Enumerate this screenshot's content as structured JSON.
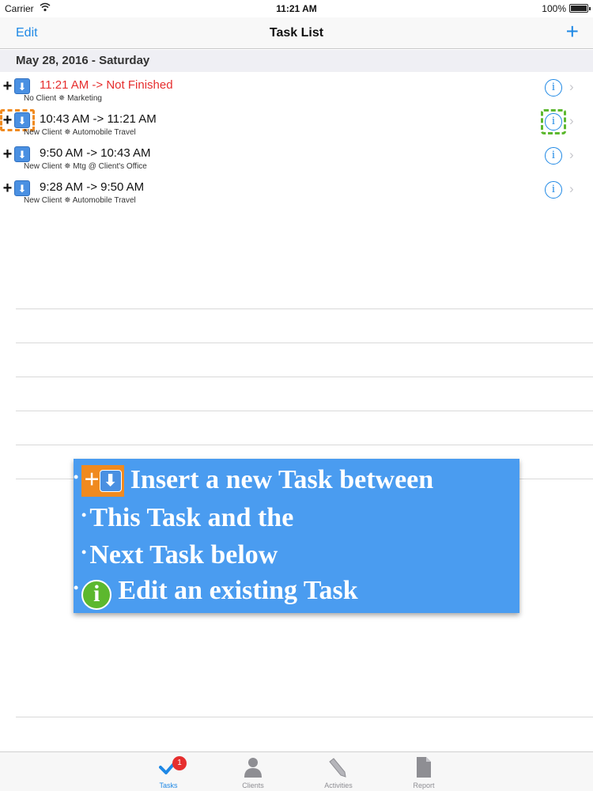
{
  "status_bar": {
    "carrier": "Carrier",
    "time": "11:21 AM",
    "battery": "100%"
  },
  "nav": {
    "edit_label": "Edit",
    "title": "Task List",
    "add_label": "+"
  },
  "section": {
    "date": "May 28, 2016 - Saturday"
  },
  "tasks": [
    {
      "time": "11:21 AM -> Not Finished",
      "meta": "No Client ✵ Marketing"
    },
    {
      "time": "10:43 AM -> 11:21 AM",
      "meta": "New Client ✵ Automobile Travel"
    },
    {
      "time": "9:50 AM -> 10:43 AM",
      "meta": "New Client ✵ Mtg @ Client's Office"
    },
    {
      "time": "9:28 AM -> 9:50 AM",
      "meta": "New Client ✵ Automobile Travel"
    }
  ],
  "row_controls": {
    "plus": "+",
    "down_arrow": "⬇",
    "info": "i",
    "chevron": "›"
  },
  "callout": {
    "bullet": "•",
    "plus": "+",
    "down_arrow": "⬇",
    "line1": "Insert a new Task between",
    "line2": "This Task and the",
    "line3": "Next Task below",
    "info": "i",
    "line4": "Edit an existing Task"
  },
  "tab_bar": {
    "tasks": "Tasks",
    "tasks_badge": "1",
    "clients": "Clients",
    "activities": "Activities",
    "report": "Report"
  },
  "colors": {
    "accent": "#1e88e5",
    "unfinished": "#e62e2e",
    "callout_bg": "#4a9cf0",
    "highlight_orange": "#f08a1f",
    "highlight_green": "#5cb82e"
  }
}
